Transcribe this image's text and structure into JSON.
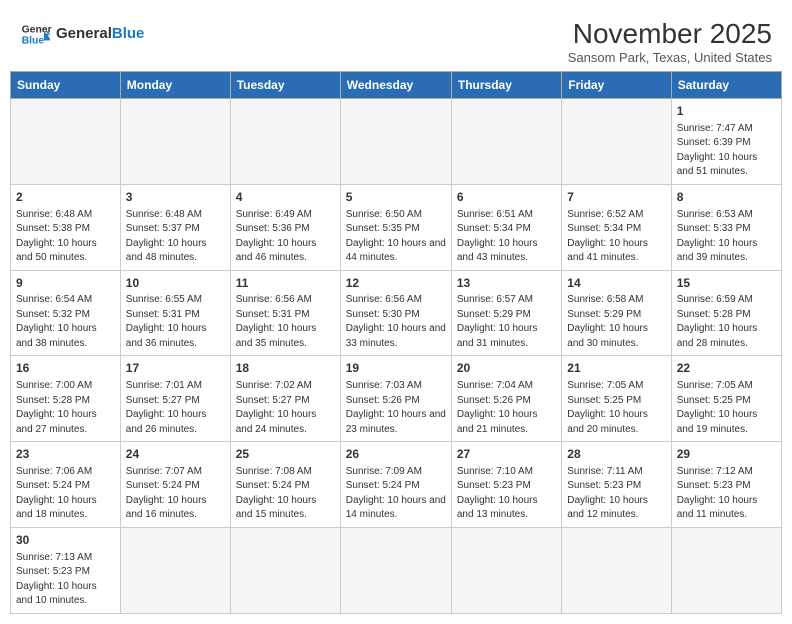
{
  "header": {
    "logo_text_general": "General",
    "logo_text_blue": "Blue",
    "month_title": "November 2025",
    "location": "Sansom Park, Texas, United States"
  },
  "days_of_week": [
    "Sunday",
    "Monday",
    "Tuesday",
    "Wednesday",
    "Thursday",
    "Friday",
    "Saturday"
  ],
  "weeks": [
    [
      {
        "day": "",
        "info": ""
      },
      {
        "day": "",
        "info": ""
      },
      {
        "day": "",
        "info": ""
      },
      {
        "day": "",
        "info": ""
      },
      {
        "day": "",
        "info": ""
      },
      {
        "day": "",
        "info": ""
      },
      {
        "day": "1",
        "info": "Sunrise: 7:47 AM\nSunset: 6:39 PM\nDaylight: 10 hours and 51 minutes."
      }
    ],
    [
      {
        "day": "2",
        "info": "Sunrise: 6:48 AM\nSunset: 5:38 PM\nDaylight: 10 hours and 50 minutes."
      },
      {
        "day": "3",
        "info": "Sunrise: 6:48 AM\nSunset: 5:37 PM\nDaylight: 10 hours and 48 minutes."
      },
      {
        "day": "4",
        "info": "Sunrise: 6:49 AM\nSunset: 5:36 PM\nDaylight: 10 hours and 46 minutes."
      },
      {
        "day": "5",
        "info": "Sunrise: 6:50 AM\nSunset: 5:35 PM\nDaylight: 10 hours and 44 minutes."
      },
      {
        "day": "6",
        "info": "Sunrise: 6:51 AM\nSunset: 5:34 PM\nDaylight: 10 hours and 43 minutes."
      },
      {
        "day": "7",
        "info": "Sunrise: 6:52 AM\nSunset: 5:34 PM\nDaylight: 10 hours and 41 minutes."
      },
      {
        "day": "8",
        "info": "Sunrise: 6:53 AM\nSunset: 5:33 PM\nDaylight: 10 hours and 39 minutes."
      }
    ],
    [
      {
        "day": "9",
        "info": "Sunrise: 6:54 AM\nSunset: 5:32 PM\nDaylight: 10 hours and 38 minutes."
      },
      {
        "day": "10",
        "info": "Sunrise: 6:55 AM\nSunset: 5:31 PM\nDaylight: 10 hours and 36 minutes."
      },
      {
        "day": "11",
        "info": "Sunrise: 6:56 AM\nSunset: 5:31 PM\nDaylight: 10 hours and 35 minutes."
      },
      {
        "day": "12",
        "info": "Sunrise: 6:56 AM\nSunset: 5:30 PM\nDaylight: 10 hours and 33 minutes."
      },
      {
        "day": "13",
        "info": "Sunrise: 6:57 AM\nSunset: 5:29 PM\nDaylight: 10 hours and 31 minutes."
      },
      {
        "day": "14",
        "info": "Sunrise: 6:58 AM\nSunset: 5:29 PM\nDaylight: 10 hours and 30 minutes."
      },
      {
        "day": "15",
        "info": "Sunrise: 6:59 AM\nSunset: 5:28 PM\nDaylight: 10 hours and 28 minutes."
      }
    ],
    [
      {
        "day": "16",
        "info": "Sunrise: 7:00 AM\nSunset: 5:28 PM\nDaylight: 10 hours and 27 minutes."
      },
      {
        "day": "17",
        "info": "Sunrise: 7:01 AM\nSunset: 5:27 PM\nDaylight: 10 hours and 26 minutes."
      },
      {
        "day": "18",
        "info": "Sunrise: 7:02 AM\nSunset: 5:27 PM\nDaylight: 10 hours and 24 minutes."
      },
      {
        "day": "19",
        "info": "Sunrise: 7:03 AM\nSunset: 5:26 PM\nDaylight: 10 hours and 23 minutes."
      },
      {
        "day": "20",
        "info": "Sunrise: 7:04 AM\nSunset: 5:26 PM\nDaylight: 10 hours and 21 minutes."
      },
      {
        "day": "21",
        "info": "Sunrise: 7:05 AM\nSunset: 5:25 PM\nDaylight: 10 hours and 20 minutes."
      },
      {
        "day": "22",
        "info": "Sunrise: 7:05 AM\nSunset: 5:25 PM\nDaylight: 10 hours and 19 minutes."
      }
    ],
    [
      {
        "day": "23",
        "info": "Sunrise: 7:06 AM\nSunset: 5:24 PM\nDaylight: 10 hours and 18 minutes."
      },
      {
        "day": "24",
        "info": "Sunrise: 7:07 AM\nSunset: 5:24 PM\nDaylight: 10 hours and 16 minutes."
      },
      {
        "day": "25",
        "info": "Sunrise: 7:08 AM\nSunset: 5:24 PM\nDaylight: 10 hours and 15 minutes."
      },
      {
        "day": "26",
        "info": "Sunrise: 7:09 AM\nSunset: 5:24 PM\nDaylight: 10 hours and 14 minutes."
      },
      {
        "day": "27",
        "info": "Sunrise: 7:10 AM\nSunset: 5:23 PM\nDaylight: 10 hours and 13 minutes."
      },
      {
        "day": "28",
        "info": "Sunrise: 7:11 AM\nSunset: 5:23 PM\nDaylight: 10 hours and 12 minutes."
      },
      {
        "day": "29",
        "info": "Sunrise: 7:12 AM\nSunset: 5:23 PM\nDaylight: 10 hours and 11 minutes."
      }
    ],
    [
      {
        "day": "30",
        "info": "Sunrise: 7:13 AM\nSunset: 5:23 PM\nDaylight: 10 hours and 10 minutes."
      },
      {
        "day": "",
        "info": ""
      },
      {
        "day": "",
        "info": ""
      },
      {
        "day": "",
        "info": ""
      },
      {
        "day": "",
        "info": ""
      },
      {
        "day": "",
        "info": ""
      },
      {
        "day": "",
        "info": ""
      }
    ]
  ]
}
